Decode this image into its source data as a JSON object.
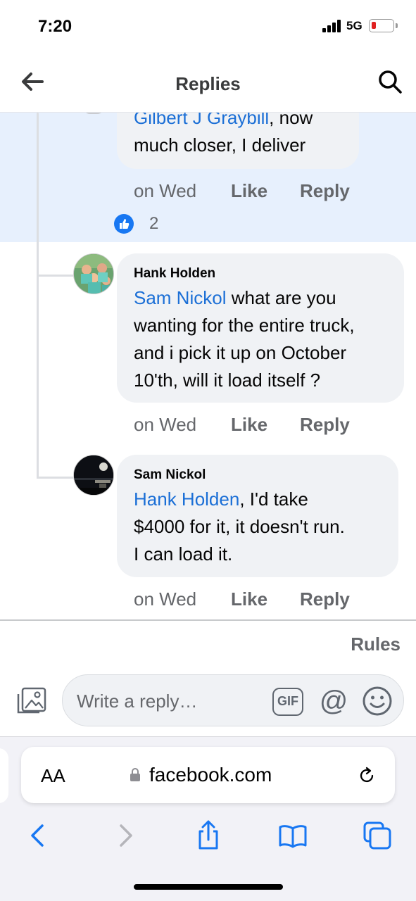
{
  "status_bar": {
    "time": "7:20",
    "network": "5G"
  },
  "header": {
    "title": "Replies"
  },
  "comments": [
    {
      "mention": "Gilbert J Graybill",
      "text_lines": [
        ",  now",
        "much closer,  I deliver"
      ],
      "time": "on Wed",
      "like_label": "Like",
      "reply_label": "Reply",
      "reactions": "2"
    },
    {
      "author": "Hank Holden",
      "mention": "Sam Nickol",
      "line1_rest": " what are you",
      "lines": [
        "wanting for the entire truck,",
        "and i pick it up on October",
        "10'th, will it load itself  ?"
      ],
      "time": "on Wed",
      "like_label": "Like",
      "reply_label": "Reply"
    },
    {
      "author": "Sam Nickol",
      "mention": "Hank Holden",
      "line1_rest": ", I'd take",
      "lines": [
        "$4000 for it, it doesn't run.",
        "I can load it."
      ],
      "time": "on Wed",
      "like_label": "Like",
      "reply_label": "Reply"
    }
  ],
  "composer": {
    "rules_label": "Rules",
    "placeholder": "Write a reply…",
    "gif_label": "GIF",
    "at_label": "@"
  },
  "browser": {
    "aa_label": "AA",
    "url": "facebook.com"
  },
  "colors": {
    "link": "#1b6fd6",
    "highlight": "#e7f0fd",
    "bubble": "#f0f2f5",
    "ios_blue": "#1877f2"
  }
}
